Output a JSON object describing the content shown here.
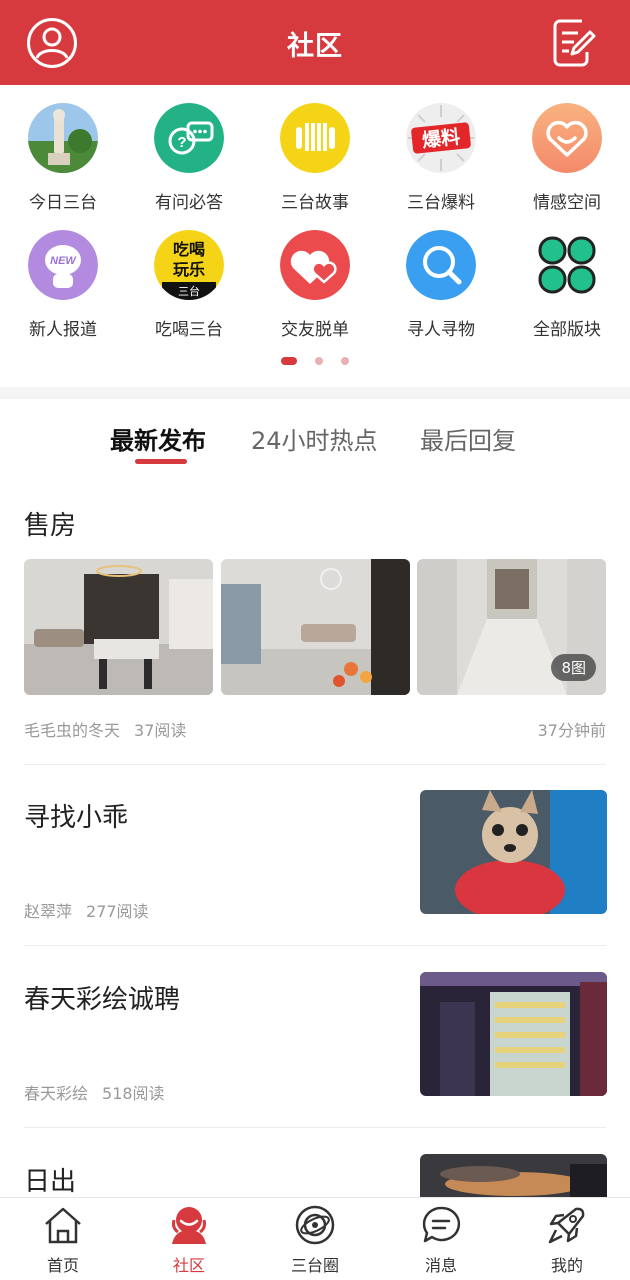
{
  "header": {
    "title": "社区"
  },
  "channels": [
    {
      "label": "今日三台",
      "icon": "statue-photo-icon"
    },
    {
      "label": "有问必答",
      "icon": "question-chat-icon"
    },
    {
      "label": "三台故事",
      "icon": "story-book-icon"
    },
    {
      "label": "三台爆料",
      "icon": "baoliao-icon",
      "icon_text": "爆料"
    },
    {
      "label": "情感空间",
      "icon": "heart-smile-icon"
    },
    {
      "label": "新人报道",
      "icon": "new-user-icon",
      "icon_text": "NEW"
    },
    {
      "label": "吃喝三台",
      "icon": "eat-drink-icon",
      "icon_text_1": "吃喝",
      "icon_text_2": "玩乐",
      "icon_text_3": "三台"
    },
    {
      "label": "交友脱单",
      "icon": "double-heart-icon"
    },
    {
      "label": "寻人寻物",
      "icon": "magnifier-icon"
    },
    {
      "label": "全部版块",
      "icon": "four-leaf-grid-icon"
    }
  ],
  "pager": {
    "pages": 3,
    "current": 1
  },
  "tabs": [
    {
      "label": "最新发布",
      "active": true
    },
    {
      "label": "24小时热点",
      "active": false
    },
    {
      "label": "最后回复",
      "active": false
    }
  ],
  "posts": [
    {
      "title": "售房",
      "author": "毛毛虫的冬天",
      "reads": "37阅读",
      "time": "37分钟前",
      "image_count": "8图"
    },
    {
      "title": "寻找小乖",
      "author": "赵翠萍",
      "reads": "277阅读"
    },
    {
      "title": "春天彩绘诚聘",
      "author": "春天彩绘",
      "reads": "518阅读"
    },
    {
      "title": "日出"
    }
  ],
  "bottom_nav": [
    {
      "label": "首页",
      "icon": "home-icon",
      "active": false
    },
    {
      "label": "社区",
      "icon": "community-icon",
      "active": true
    },
    {
      "label": "三台圈",
      "icon": "planet-icon",
      "active": false
    },
    {
      "label": "消息",
      "icon": "message-icon",
      "active": false
    },
    {
      "label": "我的",
      "icon": "rocket-icon",
      "active": false
    }
  ],
  "colors": {
    "brand": "#d63a3e",
    "meta_text": "#999999"
  }
}
